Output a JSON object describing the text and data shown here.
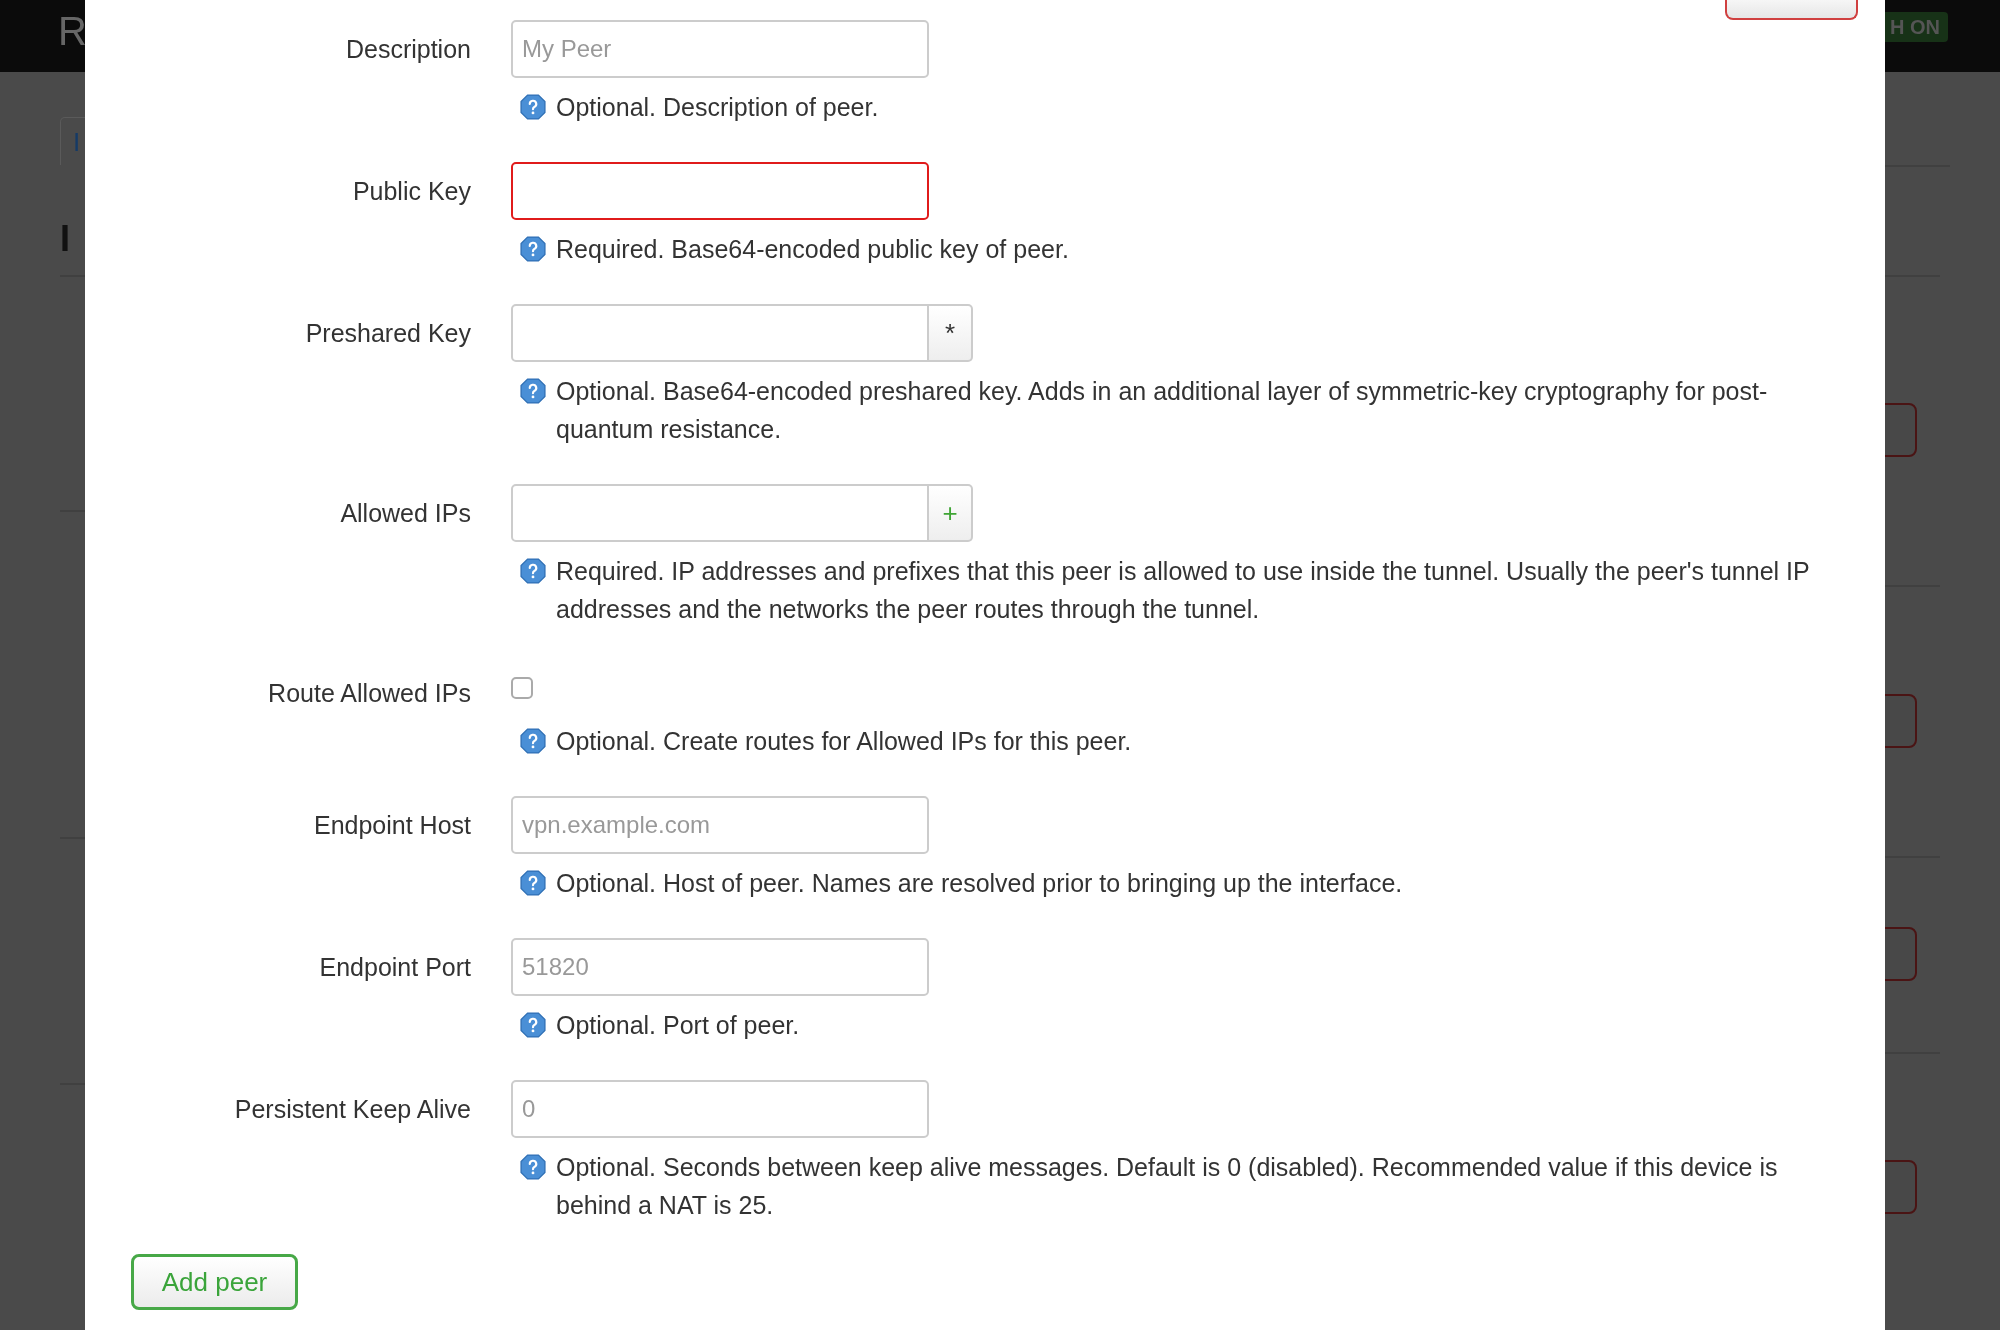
{
  "background": {
    "logo": "R",
    "tab": "I",
    "heading": "I",
    "badge": "H ON"
  },
  "fields": [
    {
      "label": "Description",
      "kind": "text",
      "placeholder": "My Peer",
      "invalid": false,
      "help": "Optional. Description of peer."
    },
    {
      "label": "Public Key",
      "kind": "text",
      "invalid": true,
      "help": "Required. Base64-encoded public key of peer."
    },
    {
      "label": "Preshared Key",
      "kind": "addon",
      "invalid": false,
      "addon": {
        "text": "*",
        "color": "#333333"
      },
      "help": "Optional. Base64-encoded preshared key. Adds in an additional layer of symmetric-key cryptography for post-quantum resistance."
    },
    {
      "label": "Allowed IPs",
      "kind": "addon",
      "invalid": false,
      "addon": {
        "text": "+",
        "color": "#3fa535"
      },
      "help": "Required. IP addresses and prefixes that this peer is allowed to use inside the tunnel. Usually the peer's tunnel IP addresses and the networks the peer routes through the tunnel."
    },
    {
      "label": "Route Allowed IPs",
      "kind": "checkbox",
      "checked": false,
      "invalid": false,
      "help": "Optional. Create routes for Allowed IPs for this peer."
    },
    {
      "label": "Endpoint Host",
      "kind": "text",
      "placeholder": "vpn.example.com",
      "invalid": false,
      "help": "Optional. Host of peer. Names are resolved prior to bringing up the interface."
    },
    {
      "label": "Endpoint Port",
      "kind": "text",
      "placeholder": "51820",
      "invalid": false,
      "help": "Optional. Port of peer."
    },
    {
      "label": "Persistent Keep Alive",
      "kind": "text",
      "placeholder": "0",
      "invalid": false,
      "help": "Optional. Seconds between keep alive messages. Default is 0 (disabled). Recommended value if this device is behind a NAT is 25."
    }
  ],
  "add_button": "Add peer"
}
